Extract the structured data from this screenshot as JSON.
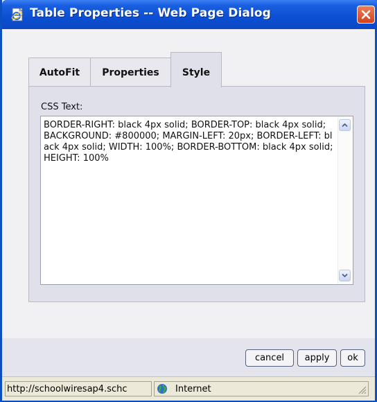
{
  "window": {
    "title": "Table Properties -- Web Page Dialog"
  },
  "icons": {
    "app": "ie-document-icon",
    "close": "close-icon",
    "scroll_up": "chevron-up-icon",
    "scroll_down": "chevron-down-icon",
    "zone": "globe-icon"
  },
  "tabs": [
    {
      "label": "AutoFit",
      "active": false
    },
    {
      "label": "Properties",
      "active": false
    },
    {
      "label": "Style",
      "active": true
    }
  ],
  "style_panel": {
    "css_label": "CSS Text:",
    "css_value": "BORDER-RIGHT: black 4px solid; BORDER-TOP: black 4px solid; BACKGROUND: #800000; MARGIN-LEFT: 20px; BORDER-LEFT: black 4px solid; WIDTH: 100%; BORDER-BOTTOM: black 4px solid; HEIGHT: 100%"
  },
  "buttons": {
    "cancel": "cancel",
    "apply": "apply",
    "ok": "ok"
  },
  "statusbar": {
    "url": "http://schoolwiresap4.schc",
    "zone": "Internet"
  },
  "colors": {
    "titlebar": "#0c4fd3",
    "close": "#d0421c",
    "panel": "#dfe0ea"
  }
}
